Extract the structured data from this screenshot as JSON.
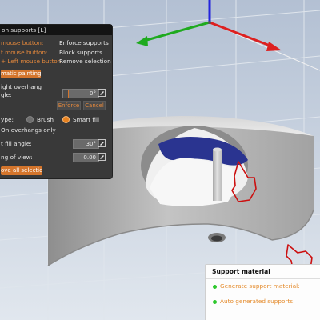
{
  "window": {
    "title": "on supports [L]"
  },
  "panel": {
    "hints": [
      {
        "key": "mouse button:",
        "value": "Enforce supports"
      },
      {
        "key": "t mouse button:",
        "value": "Block supports"
      },
      {
        "key": "+ Left mouse button:",
        "value": "Remove selection"
      }
    ],
    "auto_painting_button": "matic painting",
    "overhang_label_1": "ight overhang",
    "overhang_label_2": "gle:",
    "overhang_angle_value": "0°",
    "enforce_button": "Enforce",
    "cancel_button": "Cancel",
    "tool_type_label": "ype:",
    "tool_options": [
      "Brush",
      "Smart fill"
    ],
    "selected_tool": "Smart fill",
    "on_overhangs_only": "On overhangs only",
    "smart_fill_angle_label": "t fill angle:",
    "smart_fill_angle_value": "30°",
    "clipping_label": "ng of view:",
    "clipping_value": "0.00",
    "remove_all_button": "ove all selection"
  },
  "support_material": {
    "title": "Support material",
    "items": [
      "Generate support material:",
      "Auto generated supports:"
    ]
  },
  "colors": {
    "panel_bg": "#393939",
    "accent_orange": "#d4752c",
    "hint_key": "#e4883c",
    "axis_x": "#e02020",
    "axis_y": "#20b020",
    "axis_z": "#2020e0",
    "enforced_paint": "#2a3490",
    "status_green": "#2ec82e"
  },
  "icons": [
    "hand-cursor-icon",
    "edit-icon",
    "axis-gizmo-icon"
  ]
}
